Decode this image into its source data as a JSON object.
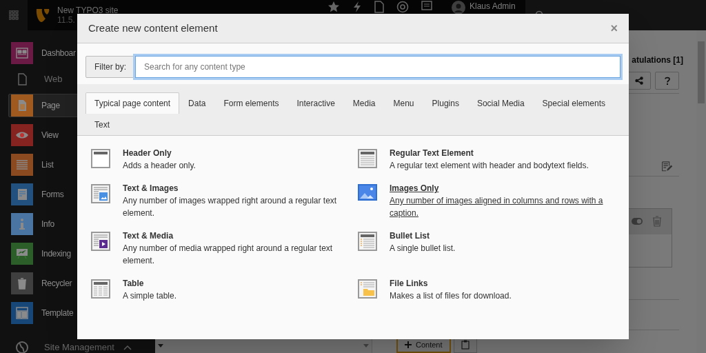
{
  "topbar": {
    "site_name": "New TYPO3 site",
    "version": "11.5.",
    "user": "Klaus Admin"
  },
  "sidebar": {
    "items": [
      {
        "kind": "module",
        "label": "Dashboar",
        "color": "#6b1a45",
        "selected": false
      },
      {
        "kind": "section",
        "label": "Web"
      },
      {
        "kind": "module",
        "label": "Page",
        "color": "#a05a20",
        "selected": true
      },
      {
        "kind": "module",
        "label": "View",
        "color": "#852321",
        "selected": false
      },
      {
        "kind": "module",
        "label": "List",
        "color": "#8b4a1f",
        "selected": false
      },
      {
        "kind": "module",
        "label": "Forms",
        "color": "#22507f",
        "selected": false
      },
      {
        "kind": "module",
        "label": "Info",
        "color": "#4a75a3",
        "selected": false
      },
      {
        "kind": "module",
        "label": "Indexing",
        "color": "#2c5e29",
        "selected": false
      },
      {
        "kind": "module",
        "label": "Recycler",
        "color": "#3f3f3f",
        "selected": false
      },
      {
        "kind": "module",
        "label": "Template",
        "color": "#174678",
        "selected": false
      },
      {
        "kind": "section",
        "label": "Site Management"
      }
    ]
  },
  "page": {
    "title": "atulations [1]",
    "content_button": "Content"
  },
  "modal": {
    "title": "Create new content element",
    "close": "×",
    "filter_label": "Filter by:",
    "search_placeholder": "Search for any content type",
    "tabs": [
      {
        "label": "Typical page content",
        "selected": true
      },
      {
        "label": "Data",
        "selected": false
      },
      {
        "label": "Form elements",
        "selected": false
      },
      {
        "label": "Interactive",
        "selected": false
      },
      {
        "label": "Media",
        "selected": false
      },
      {
        "label": "Menu",
        "selected": false
      },
      {
        "label": "Plugins",
        "selected": false
      },
      {
        "label": "Social Media",
        "selected": false
      },
      {
        "label": "Special elements",
        "selected": false
      },
      {
        "label": "Text",
        "selected": false
      }
    ],
    "elements": [
      {
        "kind": "header",
        "title": "Header Only",
        "description": "Adds a header only.",
        "hovered": false
      },
      {
        "kind": "text",
        "title": "Regular Text Element",
        "description": "A regular text element with header and bodytext fields.",
        "hovered": false
      },
      {
        "kind": "textpic",
        "title": "Text & Images",
        "description": "Any number of images wrapped right around a regular text element.",
        "hovered": false
      },
      {
        "kind": "image",
        "title": "Images Only",
        "description": "Any number of images aligned in columns and rows with a caption.",
        "hovered": true
      },
      {
        "kind": "textmedia",
        "title": "Text & Media",
        "description": "Any number of media wrapped right around a regular text element.",
        "hovered": false
      },
      {
        "kind": "bullets",
        "title": "Bullet List",
        "description": "A single bullet list.",
        "hovered": false
      },
      {
        "kind": "table",
        "title": "Table",
        "description": "A simple table.",
        "hovered": false
      },
      {
        "kind": "uploads",
        "title": "File Links",
        "description": "Makes a list of files for download.",
        "hovered": false
      }
    ]
  }
}
